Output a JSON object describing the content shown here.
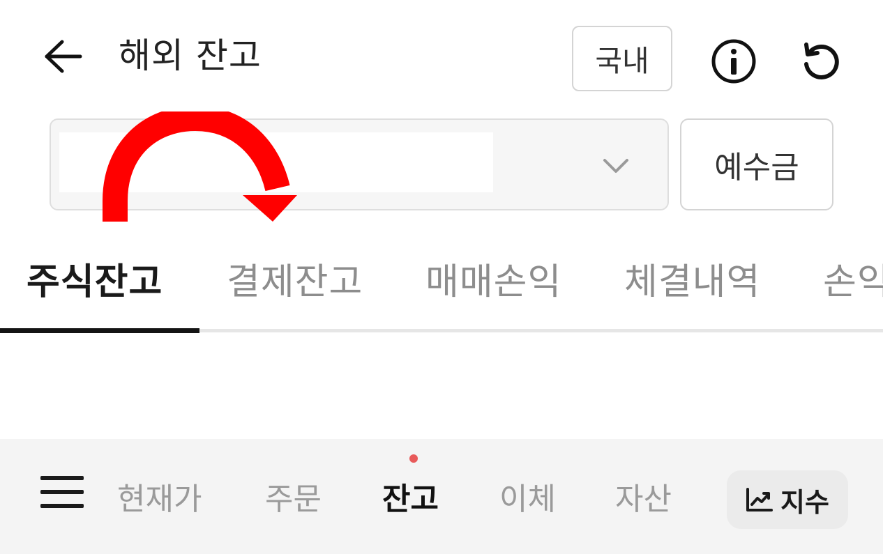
{
  "header": {
    "title": "해외 잔고",
    "domestic_label": "국내",
    "icons": {
      "back": "arrow-left-icon",
      "info": "info-icon",
      "refresh": "refresh-icon"
    }
  },
  "account": {
    "selected_value": "",
    "deposit_label": "예수금"
  },
  "tabs": [
    {
      "label": "주식잔고",
      "active": true
    },
    {
      "label": "결제잔고",
      "active": false
    },
    {
      "label": "매매손익",
      "active": false
    },
    {
      "label": "체결내역",
      "active": false
    },
    {
      "label": "손익",
      "active": false
    }
  ],
  "bottom_nav": {
    "items": [
      {
        "label": "현재가",
        "active": false
      },
      {
        "label": "주문",
        "active": false
      },
      {
        "label": "잔고",
        "active": true
      },
      {
        "label": "이체",
        "active": false
      },
      {
        "label": "자산",
        "active": false
      }
    ],
    "index_label": "지수",
    "dot_color": "#e85a5a"
  },
  "colors": {
    "annotation_arrow": "#ff0000",
    "active_tab": "#1a1a1a",
    "inactive_tab": "#8d8d8d"
  }
}
